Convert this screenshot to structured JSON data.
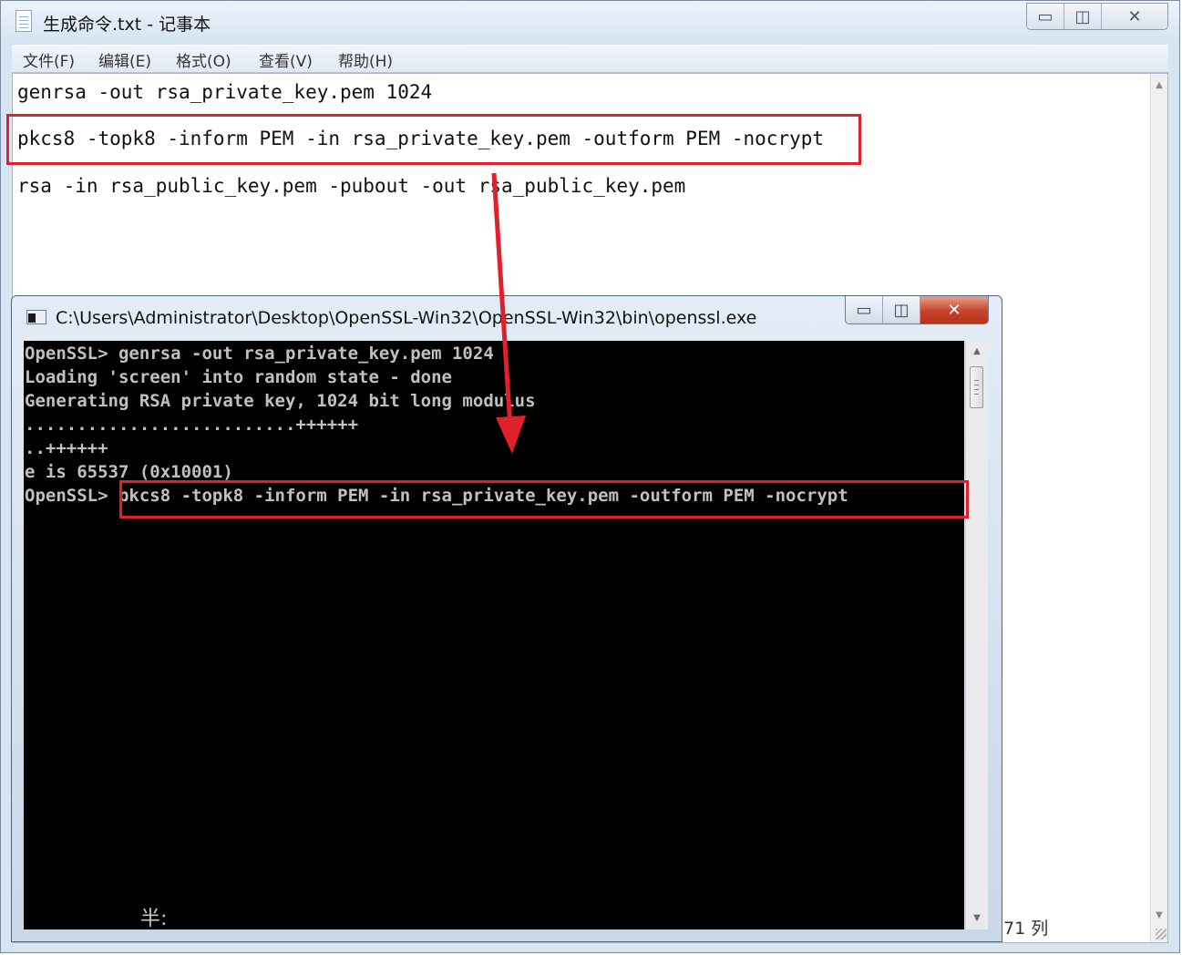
{
  "notepad": {
    "title": "生成命令.txt - 记事本",
    "controls": {
      "minimize": "▭",
      "maximize": "◫",
      "close": "✕"
    },
    "menu": [
      "文件(F)",
      "编辑(E)",
      "格式(O)",
      "查看(V)",
      "帮助(H)"
    ],
    "lines": [
      "genrsa -out rsa_private_key.pem 1024",
      "pkcs8 -topk8 -inform PEM -in rsa_private_key.pem -outform PEM -nocrypt",
      "rsa -in rsa_public_key.pem -pubout -out rsa_public_key.pem"
    ],
    "status": "71 列"
  },
  "console": {
    "title": "C:\\Users\\Administrator\\Desktop\\OpenSSL-Win32\\OpenSSL-Win32\\bin\\openssl.exe",
    "controls": {
      "minimize": "▭",
      "maximize": "◫",
      "close": "✕"
    },
    "lines": [
      "OpenSSL> genrsa -out rsa_private_key.pem 1024",
      "Loading 'screen' into random state - done",
      "Generating RSA private key, 1024 bit long modulus",
      "..........................++++++",
      "..++++++",
      "e is 65537 (0x10001)",
      "OpenSSL> pkcs8 -topk8 -inform PEM -in rsa_private_key.pem -outform PEM -nocrypt"
    ],
    "ime_indicator": "半:"
  },
  "colors": {
    "highlight": "#e0202a",
    "console_bg": "#000000",
    "console_text": "#c0c0c0"
  }
}
